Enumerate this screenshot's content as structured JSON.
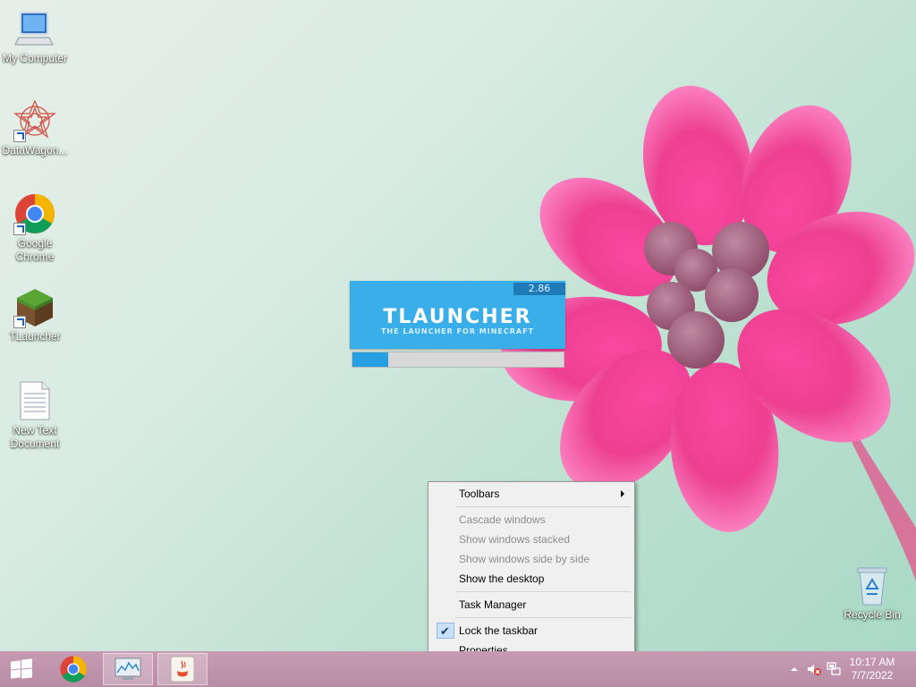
{
  "desktop": {
    "icons": [
      {
        "label": "My Computer",
        "glyph": "computer-icon"
      },
      {
        "label": "DataWagon...",
        "glyph": "datawagon-icon"
      },
      {
        "label": "Google Chrome",
        "glyph": "chrome-icon"
      },
      {
        "label": "TLauncher",
        "glyph": "minecraft-grass-icon"
      },
      {
        "label": "New Text Document",
        "glyph": "text-document-icon"
      },
      {
        "label": "Recycle Bin",
        "glyph": "recycle-bin-icon"
      }
    ]
  },
  "tlauncher": {
    "version": "2.86",
    "title": "TLAUNCHER",
    "subtitle": "THE LAUNCHER FOR MINECRAFT",
    "progress": 0.17,
    "accent": "#3aaee8"
  },
  "context_menu": {
    "items": [
      {
        "label": "Toolbars",
        "enabled": true,
        "submenu": true
      },
      {
        "label": "Cascade windows",
        "enabled": false
      },
      {
        "label": "Show windows stacked",
        "enabled": false
      },
      {
        "label": "Show windows side by side",
        "enabled": false
      },
      {
        "label": "Show the desktop",
        "enabled": true
      },
      {
        "label": "Task Manager",
        "enabled": true
      },
      {
        "label": "Lock the taskbar",
        "enabled": true,
        "checked": true
      },
      {
        "label": "Properties",
        "enabled": true
      }
    ]
  },
  "taskbar": {
    "buttons": [
      {
        "icon": "windows-start-icon"
      },
      {
        "icon": "chrome-icon"
      },
      {
        "icon": "performance-monitor-icon"
      },
      {
        "icon": "java-icon"
      }
    ],
    "tray_icons": [
      "show-hidden-icons-chevron",
      "speaker-muted-icon",
      "network-icon"
    ],
    "clock": {
      "time": "10:17 AM",
      "date": "7/7/2022"
    },
    "color": "#c79bb3"
  }
}
